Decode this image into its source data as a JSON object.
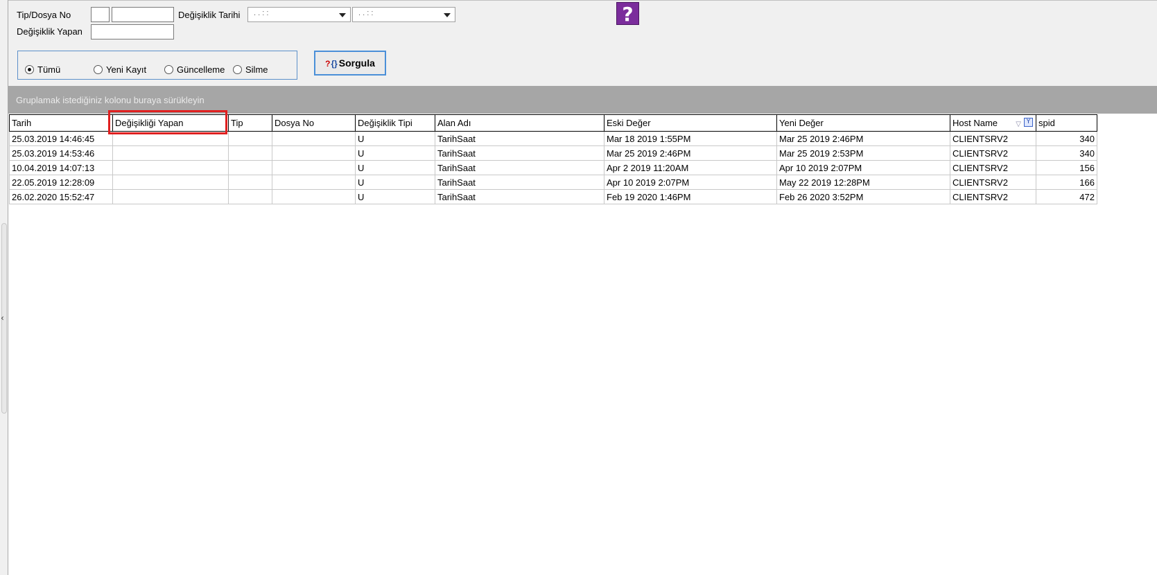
{
  "filters": {
    "tip_dosya_label": "Tip/Dosya No",
    "tip_value": "",
    "dosya_value": "",
    "tarih_label": "Değişiklik Tarihi",
    "tarih_from": ". .       : :",
    "tarih_to": ". .       : :",
    "yapan_label": "Değişiklik Yapan",
    "yapan_value": ""
  },
  "help_label": "?",
  "radios": [
    {
      "label": "Tümü",
      "checked": true
    },
    {
      "label": "Yeni Kayıt",
      "checked": false
    },
    {
      "label": "Güncelleme",
      "checked": false
    },
    {
      "label": "Silme",
      "checked": false
    }
  ],
  "query_button": {
    "label": "Sorgula",
    "icon": "query-icon"
  },
  "group_bar_text": "Gruplamak istediğiniz kolonu buraya sürükleyin",
  "grid": {
    "columns": [
      "Tarih",
      "Değişikliği Yapan",
      "Tip",
      "Dosya No",
      "Değişiklik Tipi",
      "Alan Adı",
      "Eski Değer",
      "Yeni Değer",
      "Host Name",
      "spid"
    ],
    "highlighted_column": "Değişikliği Yapan",
    "rows": [
      [
        "25.03.2019 14:46:45",
        "",
        "",
        "",
        "U",
        "TarihSaat",
        "Mar 18 2019  1:55PM",
        "Mar 25 2019  2:46PM",
        "CLIENTSRV2",
        "340"
      ],
      [
        "25.03.2019 14:53:46",
        "",
        "",
        "",
        "U",
        "TarihSaat",
        "Mar 25 2019  2:46PM",
        "Mar 25 2019  2:53PM",
        "CLIENTSRV2",
        "340"
      ],
      [
        "10.04.2019 14:07:13",
        "",
        "",
        "",
        "U",
        "TarihSaat",
        "Apr  2 2019 11:20AM",
        "Apr 10 2019  2:07PM",
        "CLIENTSRV2",
        "156"
      ],
      [
        "22.05.2019 12:28:09",
        "",
        "",
        "",
        "U",
        "TarihSaat",
        "Apr 10 2019  2:07PM",
        "May 22 2019 12:28PM",
        "CLIENTSRV2",
        "166"
      ],
      [
        "26.02.2020 15:52:47",
        "",
        "",
        "",
        "U",
        "TarihSaat",
        "Feb 19 2020  1:46PM",
        "Feb 26 2020  3:52PM",
        "CLIENTSRV2",
        "472"
      ]
    ]
  },
  "colors": {
    "highlight": "#e02020",
    "group_bar": "#a6a6a6",
    "help_bg": "#7b2d9c"
  }
}
